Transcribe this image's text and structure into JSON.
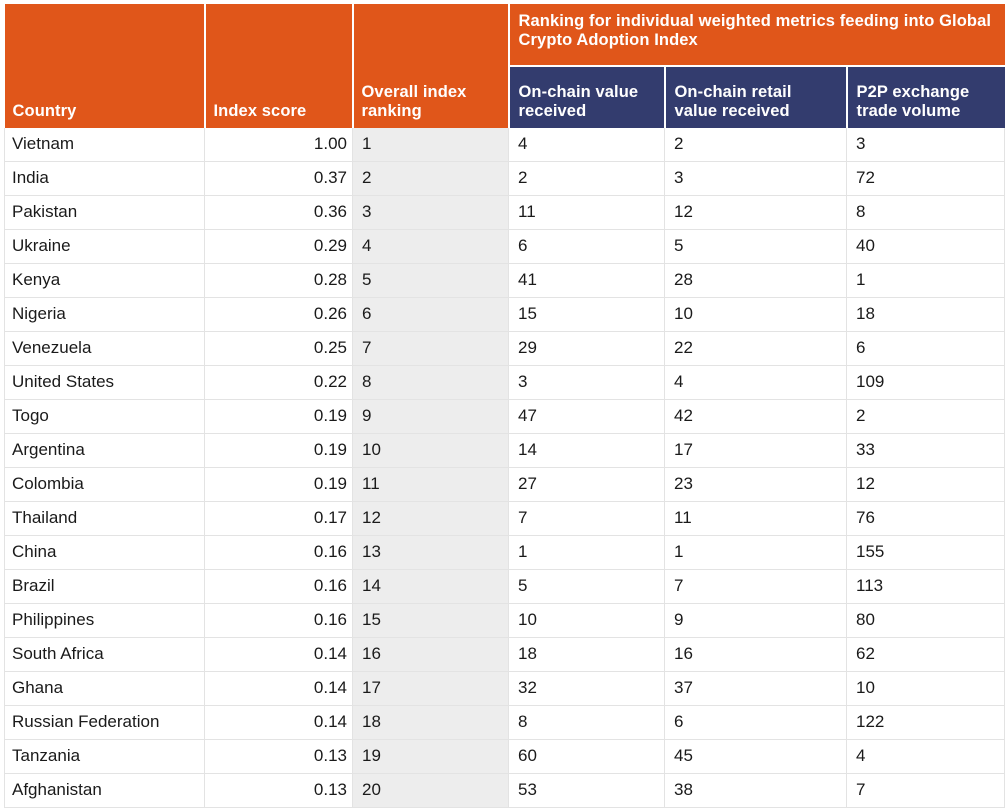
{
  "table": {
    "group_header": "Ranking for individual weighted metrics feeding into Global Crypto Adoption Index",
    "columns": [
      {
        "key": "country",
        "label": "Country"
      },
      {
        "key": "index_score",
        "label": "Index score"
      },
      {
        "key": "overall_index_ranking",
        "label": "Overall index ranking"
      },
      {
        "key": "on_chain_value_received",
        "label": "On-chain value received"
      },
      {
        "key": "on_chain_retail_value_received",
        "label": "On-chain retail value received"
      },
      {
        "key": "p2p_exchange_trade_volume",
        "label": "P2P exchange trade volume"
      }
    ],
    "colors": {
      "header_orange": "#E0561A",
      "header_blue": "#333C6E",
      "rank_column_background": "#EDEDED",
      "grid_line": "#E3E3E3",
      "header_text": "#FFFFFF",
      "body_text": "#1A1A1A"
    },
    "rows": [
      {
        "country": "Vietnam",
        "index_score": "1.00",
        "overall_index_ranking": "1",
        "on_chain_value_received": "4",
        "on_chain_retail_value_received": "2",
        "p2p_exchange_trade_volume": "3"
      },
      {
        "country": "India",
        "index_score": "0.37",
        "overall_index_ranking": "2",
        "on_chain_value_received": "2",
        "on_chain_retail_value_received": "3",
        "p2p_exchange_trade_volume": "72"
      },
      {
        "country": "Pakistan",
        "index_score": "0.36",
        "overall_index_ranking": "3",
        "on_chain_value_received": "11",
        "on_chain_retail_value_received": "12",
        "p2p_exchange_trade_volume": "8"
      },
      {
        "country": "Ukraine",
        "index_score": "0.29",
        "overall_index_ranking": "4",
        "on_chain_value_received": "6",
        "on_chain_retail_value_received": "5",
        "p2p_exchange_trade_volume": "40"
      },
      {
        "country": "Kenya",
        "index_score": "0.28",
        "overall_index_ranking": "5",
        "on_chain_value_received": "41",
        "on_chain_retail_value_received": "28",
        "p2p_exchange_trade_volume": "1"
      },
      {
        "country": "Nigeria",
        "index_score": "0.26",
        "overall_index_ranking": "6",
        "on_chain_value_received": "15",
        "on_chain_retail_value_received": "10",
        "p2p_exchange_trade_volume": "18"
      },
      {
        "country": "Venezuela",
        "index_score": "0.25",
        "overall_index_ranking": "7",
        "on_chain_value_received": "29",
        "on_chain_retail_value_received": "22",
        "p2p_exchange_trade_volume": "6"
      },
      {
        "country": "United States",
        "index_score": "0.22",
        "overall_index_ranking": "8",
        "on_chain_value_received": "3",
        "on_chain_retail_value_received": "4",
        "p2p_exchange_trade_volume": "109"
      },
      {
        "country": "Togo",
        "index_score": "0.19",
        "overall_index_ranking": "9",
        "on_chain_value_received": "47",
        "on_chain_retail_value_received": "42",
        "p2p_exchange_trade_volume": "2"
      },
      {
        "country": "Argentina",
        "index_score": "0.19",
        "overall_index_ranking": "10",
        "on_chain_value_received": "14",
        "on_chain_retail_value_received": "17",
        "p2p_exchange_trade_volume": "33"
      },
      {
        "country": "Colombia",
        "index_score": "0.19",
        "overall_index_ranking": "11",
        "on_chain_value_received": "27",
        "on_chain_retail_value_received": "23",
        "p2p_exchange_trade_volume": "12"
      },
      {
        "country": "Thailand",
        "index_score": "0.17",
        "overall_index_ranking": "12",
        "on_chain_value_received": "7",
        "on_chain_retail_value_received": "11",
        "p2p_exchange_trade_volume": "76"
      },
      {
        "country": "China",
        "index_score": "0.16",
        "overall_index_ranking": "13",
        "on_chain_value_received": "1",
        "on_chain_retail_value_received": "1",
        "p2p_exchange_trade_volume": "155"
      },
      {
        "country": "Brazil",
        "index_score": "0.16",
        "overall_index_ranking": "14",
        "on_chain_value_received": "5",
        "on_chain_retail_value_received": "7",
        "p2p_exchange_trade_volume": "113"
      },
      {
        "country": "Philippines",
        "index_score": "0.16",
        "overall_index_ranking": "15",
        "on_chain_value_received": "10",
        "on_chain_retail_value_received": "9",
        "p2p_exchange_trade_volume": "80"
      },
      {
        "country": "South Africa",
        "index_score": "0.14",
        "overall_index_ranking": "16",
        "on_chain_value_received": "18",
        "on_chain_retail_value_received": "16",
        "p2p_exchange_trade_volume": "62"
      },
      {
        "country": "Ghana",
        "index_score": "0.14",
        "overall_index_ranking": "17",
        "on_chain_value_received": "32",
        "on_chain_retail_value_received": "37",
        "p2p_exchange_trade_volume": "10"
      },
      {
        "country": "Russian Federation",
        "index_score": "0.14",
        "overall_index_ranking": "18",
        "on_chain_value_received": "8",
        "on_chain_retail_value_received": "6",
        "p2p_exchange_trade_volume": "122"
      },
      {
        "country": "Tanzania",
        "index_score": "0.13",
        "overall_index_ranking": "19",
        "on_chain_value_received": "60",
        "on_chain_retail_value_received": "45",
        "p2p_exchange_trade_volume": "4"
      },
      {
        "country": "Afghanistan",
        "index_score": "0.13",
        "overall_index_ranking": "20",
        "on_chain_value_received": "53",
        "on_chain_retail_value_received": "38",
        "p2p_exchange_trade_volume": "7"
      }
    ]
  },
  "chart_data": {
    "type": "table",
    "title": "Global Crypto Adoption Index",
    "columns": [
      "Country",
      "Index score",
      "Overall index ranking",
      "On-chain value received",
      "On-chain retail value received",
      "P2P exchange trade volume"
    ],
    "rows": [
      [
        "Vietnam",
        1.0,
        1,
        4,
        2,
        3
      ],
      [
        "India",
        0.37,
        2,
        2,
        3,
        72
      ],
      [
        "Pakistan",
        0.36,
        3,
        11,
        12,
        8
      ],
      [
        "Ukraine",
        0.29,
        4,
        6,
        5,
        40
      ],
      [
        "Kenya",
        0.28,
        5,
        41,
        28,
        1
      ],
      [
        "Nigeria",
        0.26,
        6,
        15,
        10,
        18
      ],
      [
        "Venezuela",
        0.25,
        7,
        29,
        22,
        6
      ],
      [
        "United States",
        0.22,
        8,
        3,
        4,
        109
      ],
      [
        "Togo",
        0.19,
        9,
        47,
        42,
        2
      ],
      [
        "Argentina",
        0.19,
        10,
        14,
        17,
        33
      ],
      [
        "Colombia",
        0.19,
        11,
        27,
        23,
        12
      ],
      [
        "Thailand",
        0.17,
        12,
        7,
        11,
        76
      ],
      [
        "China",
        0.16,
        13,
        1,
        1,
        155
      ],
      [
        "Brazil",
        0.16,
        14,
        5,
        7,
        113
      ],
      [
        "Philippines",
        0.16,
        15,
        10,
        9,
        80
      ],
      [
        "South Africa",
        0.14,
        16,
        18,
        16,
        62
      ],
      [
        "Ghana",
        0.14,
        17,
        32,
        37,
        10
      ],
      [
        "Russian Federation",
        0.14,
        18,
        8,
        6,
        122
      ],
      [
        "Tanzania",
        0.13,
        19,
        60,
        45,
        4
      ],
      [
        "Afghanistan",
        0.13,
        20,
        53,
        38,
        7
      ]
    ]
  }
}
